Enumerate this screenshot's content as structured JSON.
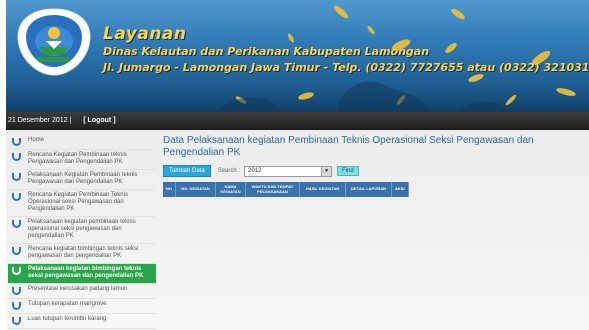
{
  "header": {
    "title": "Layanan",
    "line1": "Dinas Kelautan dan Perikanan Kabupaten Lamongan",
    "line2": "Jl. Jumargo - Lamongan Jawa Timur - Telp. (0322) 7727655 atau (0322) 321031"
  },
  "statusbar": {
    "date": "21 Desember 2012 |",
    "logout": "[ Logout ]"
  },
  "sidebar": {
    "items": [
      {
        "label": "Home"
      },
      {
        "label": "Rencana Kegiatan Pembinaan teknis Pengawasan dan Pengendalian PK"
      },
      {
        "label": "Pelaksanaan Kegiatan Pembinaan teknis Pengawasan dan Pengendalian PK"
      },
      {
        "label": "Rencana Kegiatan Pembinaan Teknis Operasional seksi Pengawasan dan Pengendalian PK"
      },
      {
        "label": "Pelaksanaan kegiatan pembinaan teknis operasional seksi pengawasan dan pengendalian PK"
      },
      {
        "label": "Rencana kegiatan bimbingan teknis seksi pengawasan dan pengendalian PK"
      },
      {
        "label": "Pelaksanaan kegiatan bimbingan teknis seksi pengawasan dan pengendalian PK"
      },
      {
        "label": "Presentase kerusakan padang lamun"
      },
      {
        "label": "Tutupan kerapatan mangrove"
      },
      {
        "label": "Luas tutupan terumbu karang"
      }
    ],
    "active_index": 6
  },
  "main": {
    "title": "Data Pelaksanaan kegiatan Pembinaan Teknis Operasional Seksi Pengawasan dan Pengendalian PK",
    "add_button": "Tambah Data",
    "search_label": "Search :",
    "year_value": "2012",
    "find_button": "Find",
    "columns": [
      "NO",
      "NO. KEGIATAN",
      "NAMA KEGIATAN",
      "WAKTU DAN TEMPAT PELAKSANAAN",
      "HASIL KEGIATAN",
      "DETAIL LAPORAN",
      "AKSI"
    ]
  },
  "colors": {
    "banner_top": "#4f98cf",
    "banner_bottom": "#123f66",
    "header_text": "#ffd24a",
    "title_blue": "#2a6aa5",
    "active_menu": "#2aa64a",
    "table_header": "#3a72ab",
    "add_button": "#27a7e0",
    "find_button": "#7de0e6"
  },
  "icons": {
    "seal": "lamongan-regency-seal-icon",
    "menu_bullet": "u-bullet-icon",
    "dropdown": "triangle-down-icon"
  }
}
